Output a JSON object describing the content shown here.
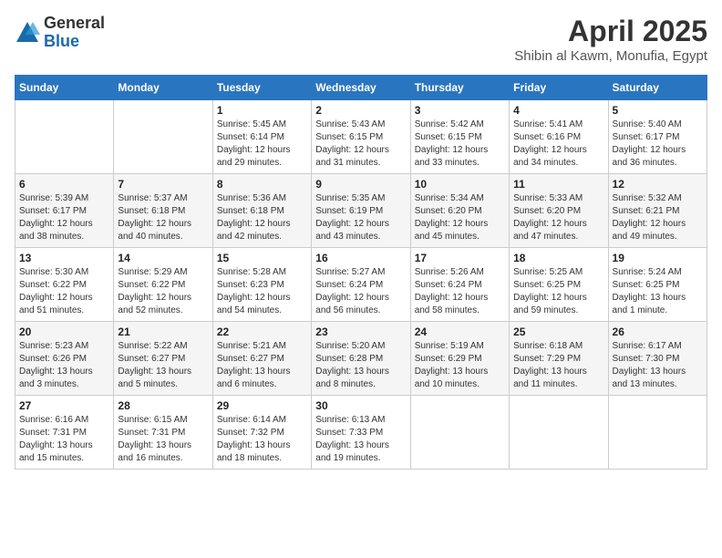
{
  "logo": {
    "general": "General",
    "blue": "Blue"
  },
  "title": "April 2025",
  "subtitle": "Shibin al Kawm, Monufia, Egypt",
  "days_of_week": [
    "Sunday",
    "Monday",
    "Tuesday",
    "Wednesday",
    "Thursday",
    "Friday",
    "Saturday"
  ],
  "weeks": [
    [
      {
        "day": "",
        "sunrise": "",
        "sunset": "",
        "daylight": ""
      },
      {
        "day": "",
        "sunrise": "",
        "sunset": "",
        "daylight": ""
      },
      {
        "day": "1",
        "sunrise": "Sunrise: 5:45 AM",
        "sunset": "Sunset: 6:14 PM",
        "daylight": "Daylight: 12 hours and 29 minutes."
      },
      {
        "day": "2",
        "sunrise": "Sunrise: 5:43 AM",
        "sunset": "Sunset: 6:15 PM",
        "daylight": "Daylight: 12 hours and 31 minutes."
      },
      {
        "day": "3",
        "sunrise": "Sunrise: 5:42 AM",
        "sunset": "Sunset: 6:15 PM",
        "daylight": "Daylight: 12 hours and 33 minutes."
      },
      {
        "day": "4",
        "sunrise": "Sunrise: 5:41 AM",
        "sunset": "Sunset: 6:16 PM",
        "daylight": "Daylight: 12 hours and 34 minutes."
      },
      {
        "day": "5",
        "sunrise": "Sunrise: 5:40 AM",
        "sunset": "Sunset: 6:17 PM",
        "daylight": "Daylight: 12 hours and 36 minutes."
      }
    ],
    [
      {
        "day": "6",
        "sunrise": "Sunrise: 5:39 AM",
        "sunset": "Sunset: 6:17 PM",
        "daylight": "Daylight: 12 hours and 38 minutes."
      },
      {
        "day": "7",
        "sunrise": "Sunrise: 5:37 AM",
        "sunset": "Sunset: 6:18 PM",
        "daylight": "Daylight: 12 hours and 40 minutes."
      },
      {
        "day": "8",
        "sunrise": "Sunrise: 5:36 AM",
        "sunset": "Sunset: 6:18 PM",
        "daylight": "Daylight: 12 hours and 42 minutes."
      },
      {
        "day": "9",
        "sunrise": "Sunrise: 5:35 AM",
        "sunset": "Sunset: 6:19 PM",
        "daylight": "Daylight: 12 hours and 43 minutes."
      },
      {
        "day": "10",
        "sunrise": "Sunrise: 5:34 AM",
        "sunset": "Sunset: 6:20 PM",
        "daylight": "Daylight: 12 hours and 45 minutes."
      },
      {
        "day": "11",
        "sunrise": "Sunrise: 5:33 AM",
        "sunset": "Sunset: 6:20 PM",
        "daylight": "Daylight: 12 hours and 47 minutes."
      },
      {
        "day": "12",
        "sunrise": "Sunrise: 5:32 AM",
        "sunset": "Sunset: 6:21 PM",
        "daylight": "Daylight: 12 hours and 49 minutes."
      }
    ],
    [
      {
        "day": "13",
        "sunrise": "Sunrise: 5:30 AM",
        "sunset": "Sunset: 6:22 PM",
        "daylight": "Daylight: 12 hours and 51 minutes."
      },
      {
        "day": "14",
        "sunrise": "Sunrise: 5:29 AM",
        "sunset": "Sunset: 6:22 PM",
        "daylight": "Daylight: 12 hours and 52 minutes."
      },
      {
        "day": "15",
        "sunrise": "Sunrise: 5:28 AM",
        "sunset": "Sunset: 6:23 PM",
        "daylight": "Daylight: 12 hours and 54 minutes."
      },
      {
        "day": "16",
        "sunrise": "Sunrise: 5:27 AM",
        "sunset": "Sunset: 6:24 PM",
        "daylight": "Daylight: 12 hours and 56 minutes."
      },
      {
        "day": "17",
        "sunrise": "Sunrise: 5:26 AM",
        "sunset": "Sunset: 6:24 PM",
        "daylight": "Daylight: 12 hours and 58 minutes."
      },
      {
        "day": "18",
        "sunrise": "Sunrise: 5:25 AM",
        "sunset": "Sunset: 6:25 PM",
        "daylight": "Daylight: 12 hours and 59 minutes."
      },
      {
        "day": "19",
        "sunrise": "Sunrise: 5:24 AM",
        "sunset": "Sunset: 6:25 PM",
        "daylight": "Daylight: 13 hours and 1 minute."
      }
    ],
    [
      {
        "day": "20",
        "sunrise": "Sunrise: 5:23 AM",
        "sunset": "Sunset: 6:26 PM",
        "daylight": "Daylight: 13 hours and 3 minutes."
      },
      {
        "day": "21",
        "sunrise": "Sunrise: 5:22 AM",
        "sunset": "Sunset: 6:27 PM",
        "daylight": "Daylight: 13 hours and 5 minutes."
      },
      {
        "day": "22",
        "sunrise": "Sunrise: 5:21 AM",
        "sunset": "Sunset: 6:27 PM",
        "daylight": "Daylight: 13 hours and 6 minutes."
      },
      {
        "day": "23",
        "sunrise": "Sunrise: 5:20 AM",
        "sunset": "Sunset: 6:28 PM",
        "daylight": "Daylight: 13 hours and 8 minutes."
      },
      {
        "day": "24",
        "sunrise": "Sunrise: 5:19 AM",
        "sunset": "Sunset: 6:29 PM",
        "daylight": "Daylight: 13 hours and 10 minutes."
      },
      {
        "day": "25",
        "sunrise": "Sunrise: 6:18 AM",
        "sunset": "Sunset: 7:29 PM",
        "daylight": "Daylight: 13 hours and 11 minutes."
      },
      {
        "day": "26",
        "sunrise": "Sunrise: 6:17 AM",
        "sunset": "Sunset: 7:30 PM",
        "daylight": "Daylight: 13 hours and 13 minutes."
      }
    ],
    [
      {
        "day": "27",
        "sunrise": "Sunrise: 6:16 AM",
        "sunset": "Sunset: 7:31 PM",
        "daylight": "Daylight: 13 hours and 15 minutes."
      },
      {
        "day": "28",
        "sunrise": "Sunrise: 6:15 AM",
        "sunset": "Sunset: 7:31 PM",
        "daylight": "Daylight: 13 hours and 16 minutes."
      },
      {
        "day": "29",
        "sunrise": "Sunrise: 6:14 AM",
        "sunset": "Sunset: 7:32 PM",
        "daylight": "Daylight: 13 hours and 18 minutes."
      },
      {
        "day": "30",
        "sunrise": "Sunrise: 6:13 AM",
        "sunset": "Sunset: 7:33 PM",
        "daylight": "Daylight: 13 hours and 19 minutes."
      },
      {
        "day": "",
        "sunrise": "",
        "sunset": "",
        "daylight": ""
      },
      {
        "day": "",
        "sunrise": "",
        "sunset": "",
        "daylight": ""
      },
      {
        "day": "",
        "sunrise": "",
        "sunset": "",
        "daylight": ""
      }
    ]
  ]
}
